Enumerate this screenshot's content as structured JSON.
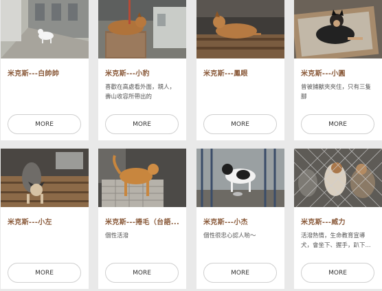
{
  "cards": [
    {
      "title": "米克斯---白帥帥",
      "desc": "",
      "more": "MORE",
      "photo_alt": "white dog walking in alley"
    },
    {
      "title": "米克斯---小豹",
      "desc": "喜歡在高處看外面，親人，壽山收容所帶出的",
      "more": "MORE",
      "photo_alt": "brown dog lying on box"
    },
    {
      "title": "米克斯---鳳眼",
      "desc": "",
      "more": "MORE",
      "photo_alt": "brown dog lying on pallet"
    },
    {
      "title": "米克斯---小圓",
      "desc": "曾被捕獸夾夾住，只有三隻腳",
      "more": "MORE",
      "photo_alt": "black and tan dog lying in bed"
    },
    {
      "title": "米克斯---小左",
      "desc": "",
      "more": "MORE",
      "photo_alt": "grey dog standing on pallet"
    },
    {
      "title": "米克斯---捲毛（台語...",
      "desc": "個性活潑",
      "more": "MORE",
      "photo_alt": "golden dog standing on grate"
    },
    {
      "title": "米克斯---小杰",
      "desc": "個性很忠心認人喲～",
      "more": "MORE",
      "photo_alt": "black and white dog in kennel"
    },
    {
      "title": "米克斯---威力",
      "desc": "活潑熱情，生命教育宣導犬，會坐下、握手，趴下...",
      "more": "MORE",
      "photo_alt": "dogs behind fence"
    }
  ],
  "colors": {
    "title": "#8a5a3a",
    "background": "#e9e9e9",
    "card": "#ffffff"
  }
}
